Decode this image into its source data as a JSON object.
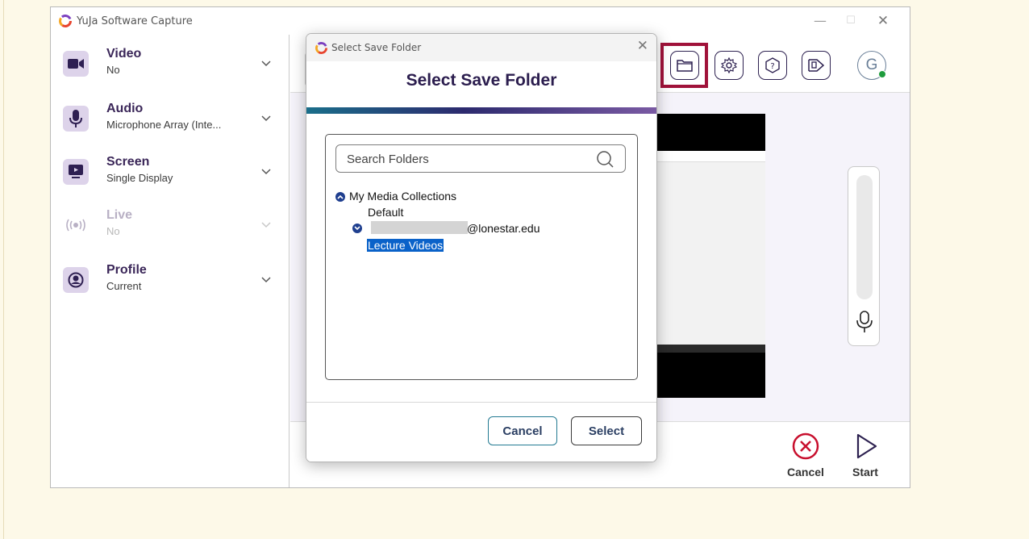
{
  "app": {
    "title": "YuJa Software Capture",
    "window_controls": {
      "minimize": "—",
      "maximize": "☐",
      "close": "✕"
    }
  },
  "sidebar": {
    "items": [
      {
        "title": "Video",
        "subtitle": "No",
        "icon": "video-camera-icon",
        "enabled": true
      },
      {
        "title": "Audio",
        "subtitle": "Microphone Array (Inte...",
        "icon": "microphone-icon",
        "enabled": true
      },
      {
        "title": "Screen",
        "subtitle": "Single Display",
        "icon": "screen-icon",
        "enabled": true
      },
      {
        "title": "Live",
        "subtitle": "No",
        "icon": "broadcast-icon",
        "enabled": false
      },
      {
        "title": "Profile",
        "subtitle": "Current",
        "icon": "profile-icon",
        "enabled": true
      }
    ]
  },
  "toolbar": {
    "buttons": [
      "folder-icon",
      "settings-gear-icon",
      "help-icon",
      "announcement-icon"
    ],
    "highlighted": "folder-icon",
    "avatar_initial": "G",
    "avatar_status_color": "#1f9c3d"
  },
  "footer": {
    "cancel_label": "Cancel",
    "start_label": "Start"
  },
  "dialog": {
    "window_title": "Select Save Folder",
    "close_glyph": "✕",
    "heading": "Select Save Folder",
    "search_placeholder": "Search Folders",
    "tree": {
      "root": "My Media Collections",
      "default": "Default",
      "account_suffix": "@lonestar.edu",
      "selected_folder": "Lecture Videos"
    },
    "cancel_label": "Cancel",
    "select_label": "Select"
  },
  "colors": {
    "accent_dark": "#2b1d4e",
    "highlight_border": "#a0123a",
    "selection": "#0a62c9",
    "page_background": "#fdf9e8"
  }
}
